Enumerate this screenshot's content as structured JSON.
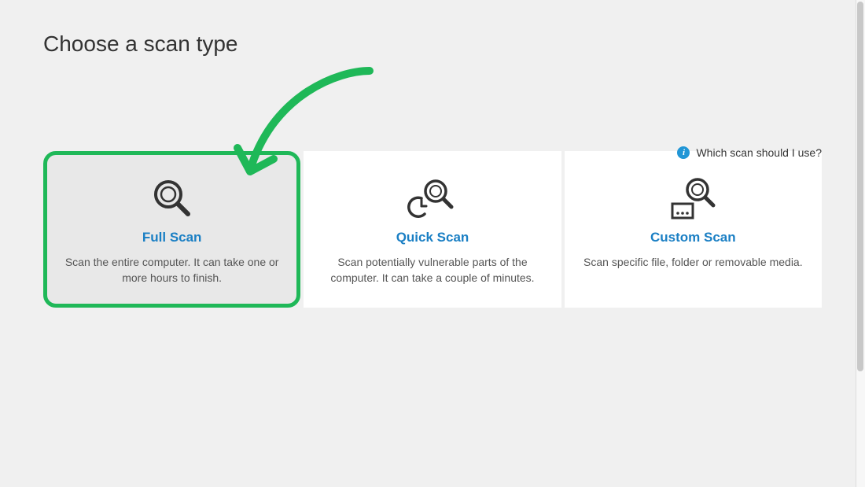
{
  "page": {
    "title": "Choose a scan type"
  },
  "help": {
    "label": "Which scan should I use?"
  },
  "cards": {
    "full": {
      "title": "Full Scan",
      "desc": "Scan the entire computer. It can take one or more hours to finish."
    },
    "quick": {
      "title": "Quick Scan",
      "desc": "Scan potentially vulnerable parts of the computer. It can take a couple of minutes."
    },
    "custom": {
      "title": "Custom Scan",
      "desc": "Scan specific file, folder or removable media."
    }
  },
  "annotation": {
    "highlight_color": "#1fb858"
  }
}
